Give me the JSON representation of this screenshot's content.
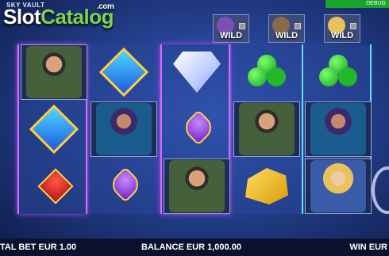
{
  "header": {
    "game_title": "SKY VAULT",
    "watermark_part1": "Slot",
    "watermark_part2": "Catalog",
    "watermark_part3": ".com",
    "debug_label": "DEBUG"
  },
  "wild_indicators": [
    {
      "label": "WILD",
      "character": "woman-with-goggles"
    },
    {
      "label": "WILD",
      "character": "man-with-beanie"
    },
    {
      "label": "WILD",
      "character": "blonde-woman"
    }
  ],
  "reels": [
    [
      "man-with-beanie",
      "blue-diamond-suit",
      "red-heart-suit"
    ],
    [
      "blue-diamond-suit",
      "woman-with-goggles",
      "purple-spade-suit"
    ],
    [
      "white-diamond",
      "purple-spade-suit",
      "man-with-beanie"
    ],
    [
      "green-club-suit",
      "man-with-beanie",
      "gold-bars"
    ],
    [
      "green-club-suit",
      "woman-with-goggles",
      "blonde-woman"
    ]
  ],
  "footer": {
    "total_bet": "TAL BET EUR 1.00",
    "balance": "BALANCE EUR 1,000.00",
    "win": "WIN EUR"
  },
  "colors": {
    "watermark_accent": "#7fd34a",
    "reel_highlight": "#d86cff",
    "debug_bar": "#1aa32b"
  }
}
